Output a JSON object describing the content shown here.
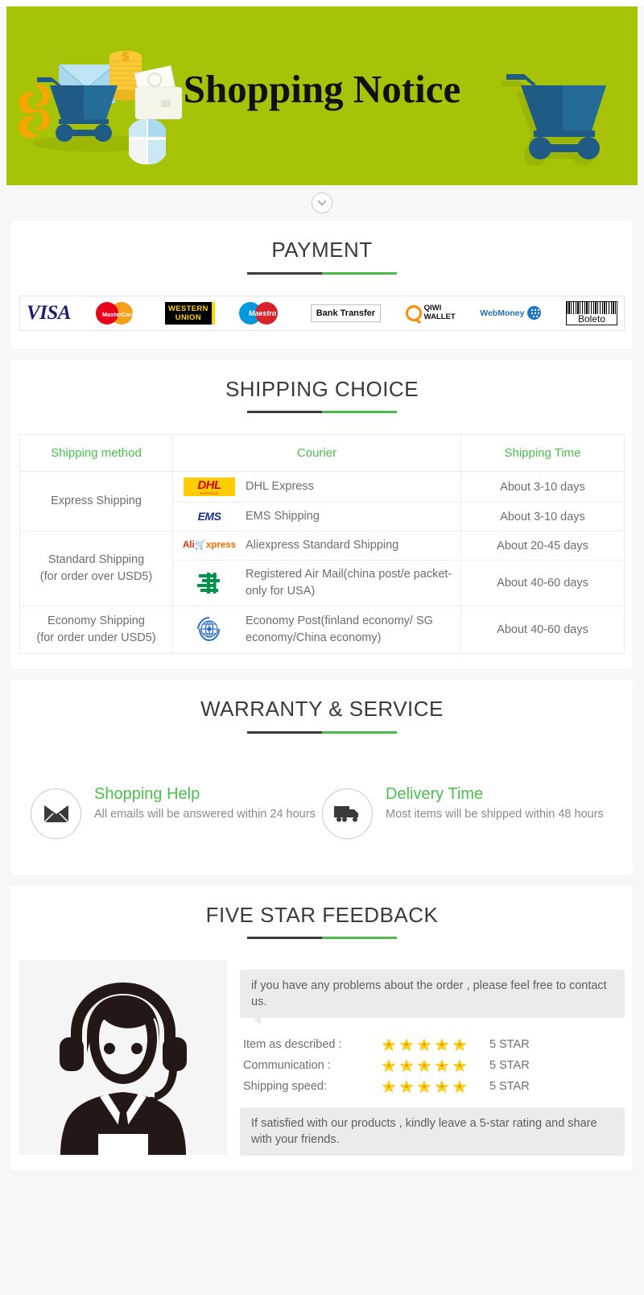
{
  "banner": {
    "title": "Shopping Notice",
    "bg_color": "#a6c307"
  },
  "divider": {
    "icon": "chevron-down-icon"
  },
  "payment": {
    "title": "PAYMENT",
    "methods": [
      {
        "name": "VISA",
        "icon": "visa-logo"
      },
      {
        "name": "MasterCard",
        "icon": "mastercard-logo"
      },
      {
        "name": "WESTERN UNION",
        "line1": "WESTERN",
        "line2": "UNION",
        "icon": "western-union-logo"
      },
      {
        "name": "Maestro",
        "icon": "maestro-logo"
      },
      {
        "name": "Bank Transfer",
        "icon": "bank-transfer-logo"
      },
      {
        "name": "QIWI WALLET",
        "line1": "QIWI",
        "line2": "WALLET",
        "icon": "qiwi-wallet-logo"
      },
      {
        "name": "WebMoney",
        "icon": "webmoney-logo"
      },
      {
        "name": "Boleto",
        "icon": "boleto-logo"
      }
    ]
  },
  "shipping": {
    "title": "SHIPPING CHOICE",
    "headers": [
      "Shipping method",
      "Courier",
      "Shipping Time"
    ],
    "groups": [
      {
        "method": "Express Shipping",
        "method_note": "",
        "rows": [
          {
            "logo": "dhl-logo",
            "courier": "DHL Express",
            "time": "About 3-10 days"
          },
          {
            "logo": "ems-logo",
            "courier": "EMS Shipping",
            "time": "About 3-10 days"
          }
        ]
      },
      {
        "method": "Standard Shipping",
        "method_note": "(for order over USD5)",
        "rows": [
          {
            "logo": "aliexpress-logo",
            "courier": "Aliexpress Standard Shipping",
            "time": "About 20-45 days"
          },
          {
            "logo": "china-post-logo",
            "courier": "Registered Air Mail(china post/e packet-only for USA)",
            "time": "About 40-60 days"
          }
        ]
      },
      {
        "method": "Economy Shipping",
        "method_note": "(for order under USD5)",
        "rows": [
          {
            "logo": "un-logo",
            "courier": "Economy Post(finland economy/ SG economy/China economy)",
            "time": "About 40-60 days"
          }
        ]
      }
    ]
  },
  "warranty": {
    "title": "WARRANTY & SERVICE",
    "items": [
      {
        "icon": "envelope-icon",
        "title": "Shopping Help",
        "desc": "All emails will be answered within 24 hours"
      },
      {
        "icon": "truck-icon",
        "title": "Delivery Time",
        "desc": "Most items will be shipped within 48 hours"
      }
    ]
  },
  "feedback": {
    "title": "FIVE STAR FEEDBACK",
    "photo_icon": "customer-service-agent-icon",
    "bubble_top": "if you have any problems about the order , please feel free to contact us.",
    "ratings": [
      {
        "label": "Item as described :",
        "stars": 5,
        "value": "5 STAR"
      },
      {
        "label": "Communication :",
        "stars": 5,
        "value": "5 STAR"
      },
      {
        "label": "Shipping speed:",
        "stars": 5,
        "value": "5 STAR"
      }
    ],
    "bubble_bottom": "If satisfied with our products , kindly leave a 5-star rating and share with your friends.",
    "star_color": "#ffd21e"
  },
  "colors": {
    "accent_green": "#4cc04c",
    "rule_dark": "#3c3c3c",
    "page_bg": "#f7f7f7"
  }
}
